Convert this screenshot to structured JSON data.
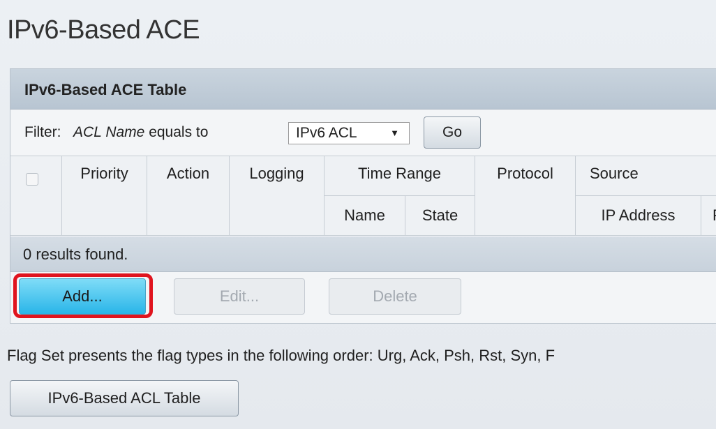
{
  "page": {
    "title": "IPv6-Based ACE",
    "note": "Flag Set presents the flag types in the following order: Urg, Ack, Psh, Rst, Syn, F"
  },
  "panel": {
    "title": "IPv6-Based ACE Table"
  },
  "filter": {
    "label": "Filter:",
    "field": "ACL Name",
    "operator": "equals to",
    "selected": "IPv6 ACL",
    "caret": "▼",
    "go_label": "Go"
  },
  "table": {
    "headers": {
      "priority": "Priority",
      "action": "Action",
      "logging": "Logging",
      "time_range": "Time Range",
      "time_range_name": "Name",
      "time_range_state": "State",
      "protocol": "Protocol",
      "source": "Source",
      "source_ip": "IP Address",
      "source_prefix_partial": "P"
    },
    "results_text": "0 results found.",
    "rows": []
  },
  "buttons": {
    "add": "Add...",
    "edit": "Edit...",
    "delete": "Delete",
    "acl_table": "IPv6-Based ACL Table"
  },
  "colors": {
    "highlight": "#e0141e",
    "add_button": "#29b5e8"
  }
}
